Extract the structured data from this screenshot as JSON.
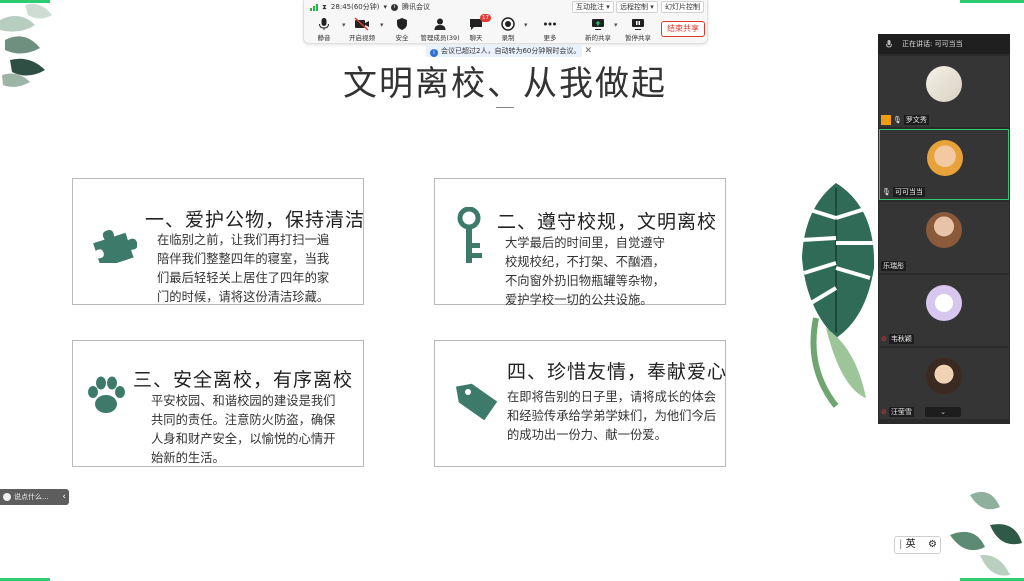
{
  "meeting_bar": {
    "timer": "28:45(60分钟)",
    "meeting_name": "腾讯会议",
    "interactive_annotation": "互动批注",
    "remote_control": "远程控制",
    "slideshow_control": "幻灯片控制",
    "tools": [
      {
        "label": "静音"
      },
      {
        "label": "开启视频"
      },
      {
        "label": "安全"
      },
      {
        "label": "管理成员(39)"
      },
      {
        "label": "聊天",
        "badge": "17"
      },
      {
        "label": "录制"
      },
      {
        "label": "更多"
      },
      {
        "label": "新的共享"
      },
      {
        "label": "暂停共享"
      }
    ],
    "end_share": "结束共享",
    "notice": "会议已超过2人，自动转为60分钟限时会议。"
  },
  "slide": {
    "title": "文明离校、从我做起",
    "cards": [
      {
        "title": "一、爱护公物，保持清洁",
        "text": "在临别之前，让我们再打扫一遍陪伴我们整整四年的寝室，当我们最后轻轻关上居住了四年的家门的时候，请将这份清洁珍藏。",
        "icon": "puzzle-icon"
      },
      {
        "title": "二、遵守校规，文明离校",
        "text": "大学最后的时间里，自觉遵守校规校纪，不打架、不酗酒，不向窗外扔旧物瓶罐等杂物，爱护学校一切的公共设施。",
        "icon": "key-icon"
      },
      {
        "title": "三、安全离校，有序离校",
        "text": "平安校园、和谐校园的建设是我们共同的责任。注意防火防盗，确保人身和财产安全，以愉悦的心情开始新的生活。",
        "icon": "paw-icon"
      },
      {
        "title": "四、珍惜友情，奉献爱心",
        "text": "在即将告别的日子里，请将成长的体会和经验传承给学弟学妹们，为他们今后的成功出一份力、献一份爱。",
        "icon": "tag-icon"
      }
    ]
  },
  "panel": {
    "speaking": "正在讲话: 可可当当",
    "participants": [
      {
        "name": "罗文秀"
      },
      {
        "name": "可可当当"
      },
      {
        "name": "乐瑞彤"
      },
      {
        "name": "韦秋颖"
      },
      {
        "name": "汪莹雪"
      }
    ]
  },
  "chat_pill": "说点什么...",
  "ime": {
    "mode": "英"
  },
  "colors": {
    "accent": "#3d7a6a",
    "end_share": "#e0392b",
    "active_tile": "#2ecc71"
  }
}
